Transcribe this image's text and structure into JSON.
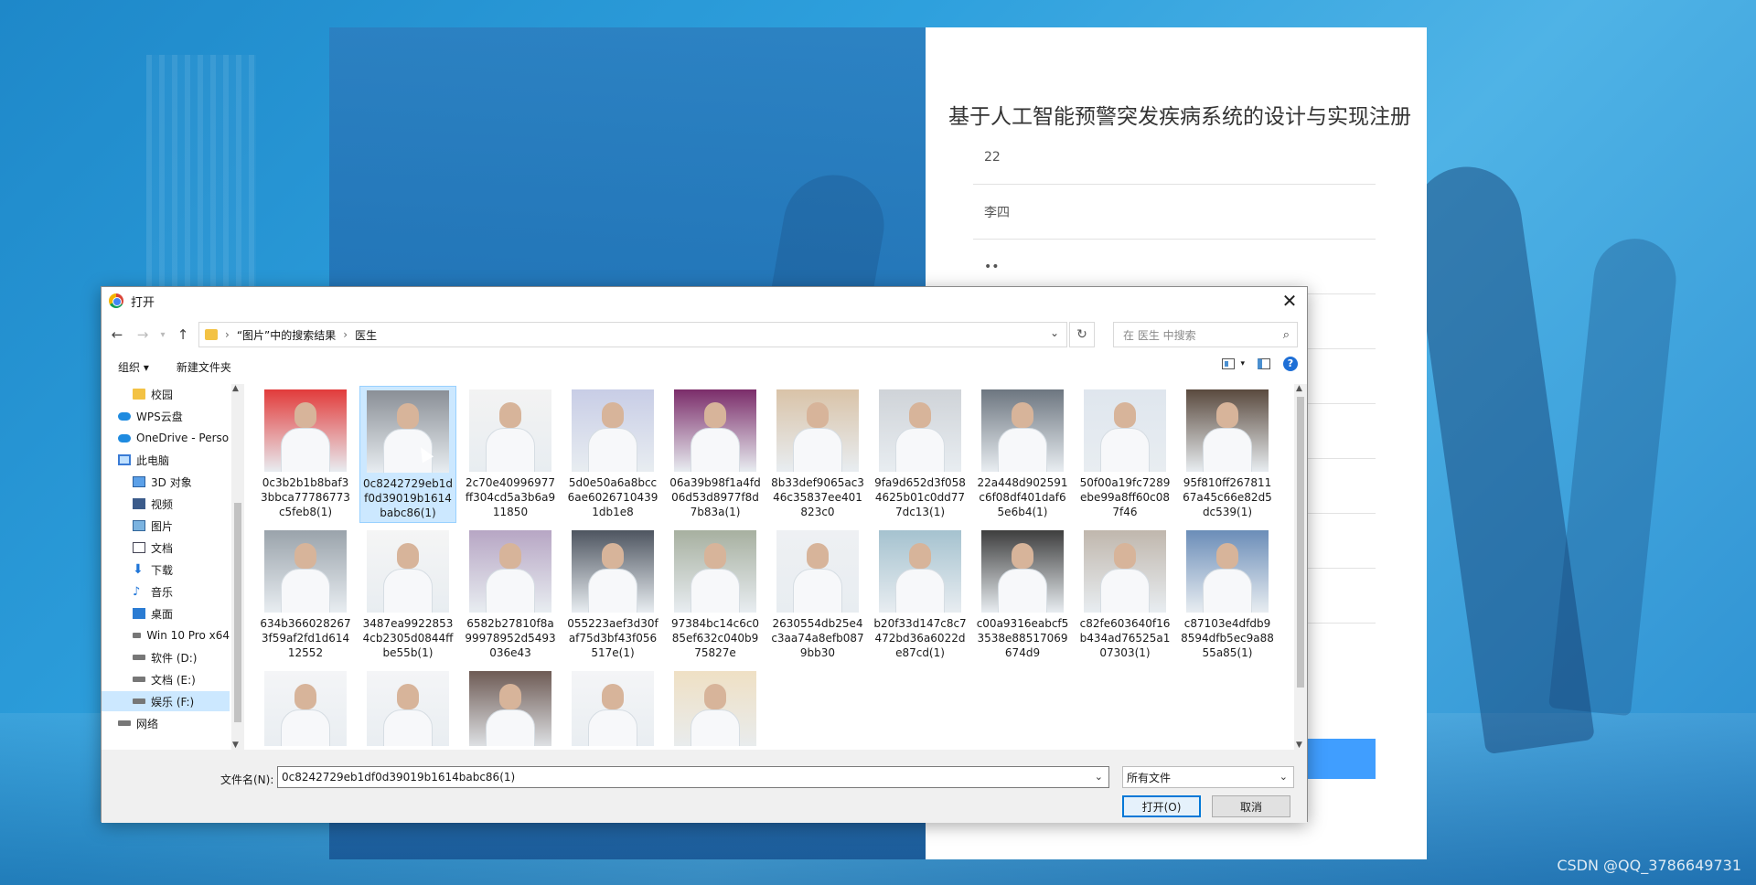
{
  "registration": {
    "title": "基于人工智能预警突发疾病系统的设计与实现注册",
    "fields": [
      "22",
      "李四",
      "••",
      "",
      "",
      "",
      "",
      "",
      ""
    ]
  },
  "watermark": "CSDN @QQ_3786649731",
  "dialog": {
    "title": "打开",
    "close": "✕",
    "breadcrumb": {
      "crumb1": "“图片”中的搜索结果",
      "crumb2": "医生"
    },
    "search_placeholder": "在 医生 中搜索",
    "toolbar": {
      "organize": "组织 ▾",
      "new_folder": "新建文件夹"
    },
    "sidebar": [
      {
        "label": "校园",
        "icon": "folder-icon"
      },
      {
        "label": "WPS云盘",
        "icon": "cloud-icon"
      },
      {
        "label": "OneDrive - Perso",
        "icon": "cloud-icon"
      },
      {
        "label": "此电脑",
        "icon": "computer-icon"
      },
      {
        "label": "3D 对象",
        "icon": "3d-objects-icon"
      },
      {
        "label": "视频",
        "icon": "video-icon"
      },
      {
        "label": "图片",
        "icon": "pictures-icon"
      },
      {
        "label": "文档",
        "icon": "documents-icon"
      },
      {
        "label": "下载",
        "icon": "download-icon"
      },
      {
        "label": "音乐",
        "icon": "music-icon"
      },
      {
        "label": "桌面",
        "icon": "desktop-icon"
      },
      {
        "label": "Win 10 Pro x64",
        "icon": "drive-icon"
      },
      {
        "label": "软件 (D:)",
        "icon": "drive-icon"
      },
      {
        "label": "文档 (E:)",
        "icon": "drive-icon"
      },
      {
        "label": "娱乐 (F:)",
        "icon": "drive-icon"
      },
      {
        "label": "网络",
        "icon": "network-icon"
      }
    ],
    "files": [
      {
        "name": "0c3b2b1b8baf33bbca77786773c5feb8(1)",
        "color": "#e23b3b"
      },
      {
        "name": "0c8242729eb1df0d39019b1614babc86(1)",
        "color": "#8a8f96"
      },
      {
        "name": "2c70e40996977ff304cd5a3b6a911850",
        "color": "#f3f3f3"
      },
      {
        "name": "5d0e50a6a8bcc6ae60267104391db1e8",
        "color": "#c8cde6"
      },
      {
        "name": "06a39b98f1a4fd06d53d8977f8d7b83a(1)",
        "color": "#7b2d6a"
      },
      {
        "name": "8b33def9065ac346c35837ee401823c0",
        "color": "#d9c3a8"
      },
      {
        "name": "9fa9d652d3f0584625b01c0dd777dc13(1)",
        "color": "#cfd3d8"
      },
      {
        "name": "22a448d902591c6f08df401daf65e6b4(1)",
        "color": "#6d7680"
      },
      {
        "name": "50f00a19fc7289ebe99a8ff60c087f46",
        "color": "#dfe6ee"
      },
      {
        "name": "95f810ff26781167a45c66e82d5dc539(1)",
        "color": "#5a4a3e"
      },
      {
        "name": "634b3660282673f59af2fd1d61412552",
        "color": "#9aa3ab"
      },
      {
        "name": "3487ea99228534cb2305d0844ffbe55b(1)",
        "color": "#f5f5f5"
      },
      {
        "name": "6582b27810f8a99978952d5493036e43",
        "color": "#b7a6c4"
      },
      {
        "name": "055223aef3d30faf75d3bf43f056517e(1)",
        "color": "#4e5560"
      },
      {
        "name": "97384bc14c6c085ef632c040b975827e",
        "color": "#a7b0a0"
      },
      {
        "name": "2630554db25e4c3aa74a8efb0879bb30",
        "color": "#eef0f3"
      },
      {
        "name": "b20f33d147c8c7472bd36a6022de87cd(1)",
        "color": "#a5c2cf"
      },
      {
        "name": "c00a9316eabcf53538e88517069674d9",
        "color": "#3e3e3e"
      },
      {
        "name": "c82fe603640f16b434ad76525a107303(1)",
        "color": "#c0b7ad"
      },
      {
        "name": "c87103e4dfdb98594dfb5ec9a8855a85(1)",
        "color": "#6b8db8"
      },
      {
        "name": "",
        "color": "#f4f5f7"
      },
      {
        "name": "",
        "color": "#f4f5f7"
      },
      {
        "name": "",
        "color": "#6e5b55"
      },
      {
        "name": "",
        "color": "#f4f5f7"
      },
      {
        "name": "",
        "color": "#efe0c4"
      }
    ],
    "filename_label": "文件名(N):",
    "filename_value": "0c8242729eb1df0d39019b1614babc86(1)",
    "filetype": "所有文件",
    "open_button": "打开(O)",
    "cancel_button": "取消"
  }
}
